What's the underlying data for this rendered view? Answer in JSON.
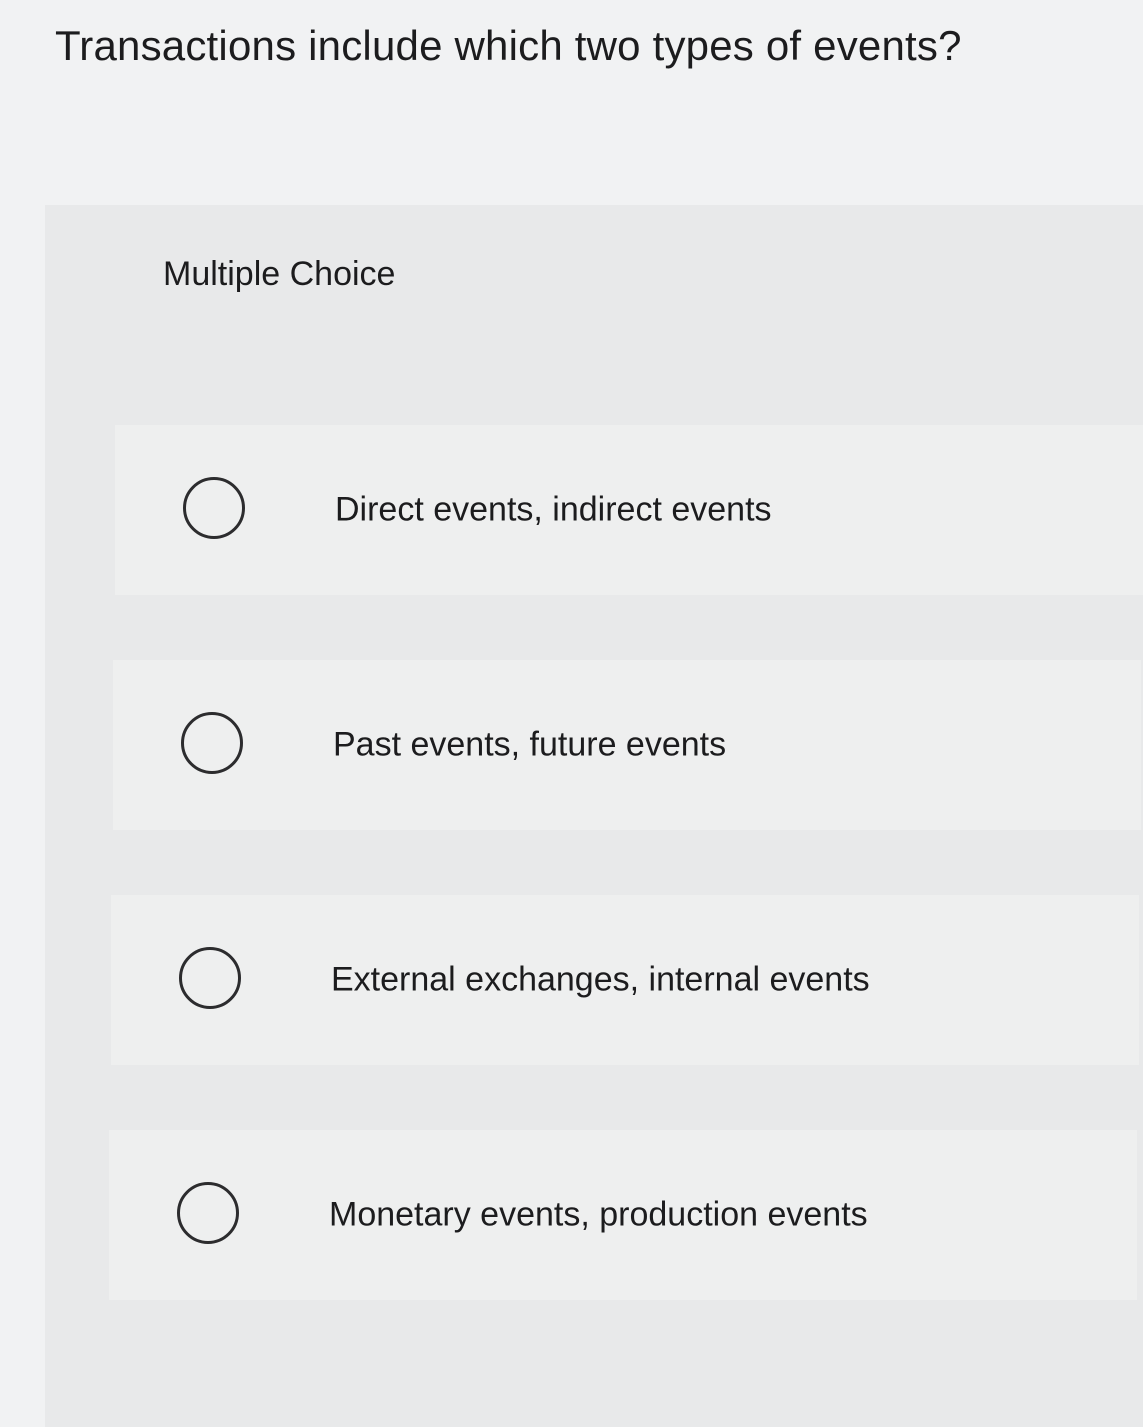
{
  "question": {
    "text": "Transactions include which two types of events?"
  },
  "question_type": "Multiple Choice",
  "options": [
    {
      "label": "Direct events, indirect events",
      "selected": false
    },
    {
      "label": "Past events, future events",
      "selected": false
    },
    {
      "label": "External exchanges, internal events",
      "selected": false
    },
    {
      "label": "Monetary events, production events",
      "selected": false
    }
  ],
  "colors": {
    "background": "#f1f2f3",
    "panel": "#e8e9ea",
    "option_background": "#eeefef",
    "text": "#1c1c1e",
    "radio_border": "#2c2c2e"
  }
}
